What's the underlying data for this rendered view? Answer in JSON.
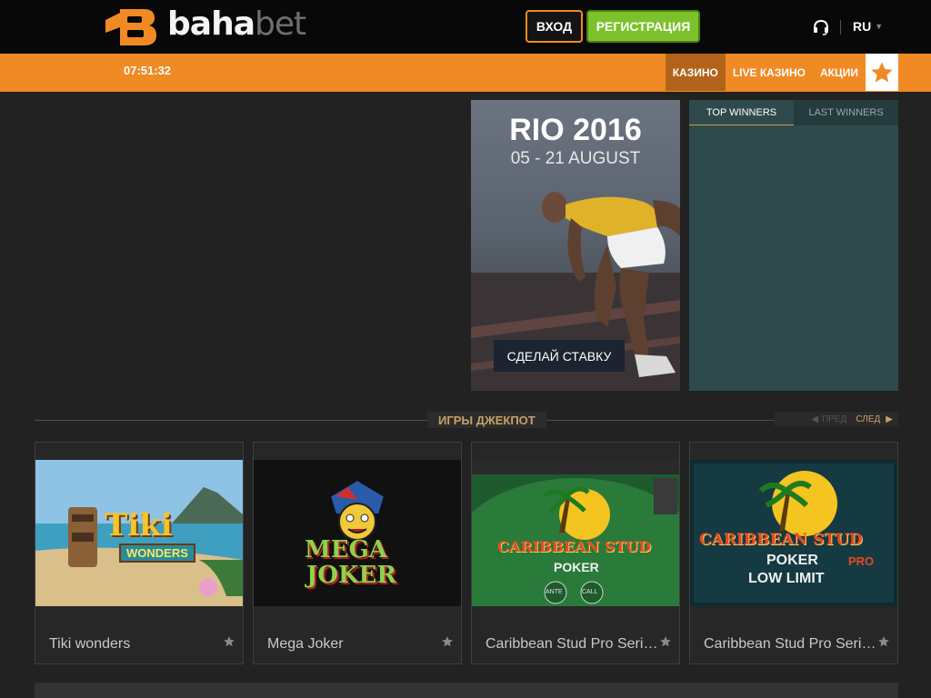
{
  "header": {
    "logo_text_a": "baha",
    "logo_text_b": "bet",
    "login_label": "ВХОД",
    "register_label": "РЕГИСТРАЦИЯ",
    "language": "RU",
    "support_icon": "headset-icon",
    "brand_color": "#f08a24"
  },
  "subnav": {
    "clock": "07:51:32",
    "items": [
      "КАЗИНО",
      "LIVE КАЗИНО",
      "АКЦИИ"
    ],
    "active_index": 0,
    "favorites_icon": "star-icon"
  },
  "banner": {
    "title": "RIO 2016",
    "subtitle": "05 - 21 AUGUST",
    "cta_label": "СДЕЛАЙ СТАВКУ"
  },
  "winners": {
    "tabs": [
      "TOP WINNERS",
      "LAST WINNERS"
    ],
    "active_tab": 0
  },
  "jackpot": {
    "section_title": "ИГРЫ ДЖЕКПОТ",
    "prev_label": "ПРЕД",
    "next_label": "СЛЕД",
    "games": [
      {
        "name": "Tiki wonders"
      },
      {
        "name": "Mega Joker"
      },
      {
        "name": "Caribbean Stud Pro Series"
      },
      {
        "name": "Caribbean Stud Pro Series Low Limit"
      }
    ]
  },
  "game_art": {
    "tiki_a": "Tiki",
    "tiki_b": "WONDERS",
    "joker_a": "MEGA",
    "joker_b": "JOKER",
    "stud_a": "CARIBBEAN STUD",
    "stud_b": "POKER",
    "stud_chip_a": "ANTE",
    "stud_chip_b": "CALL",
    "low_a": "CARIBBEAN STUD",
    "low_b": "POKER",
    "low_c": "PRO",
    "low_d": "LOW LIMIT"
  }
}
